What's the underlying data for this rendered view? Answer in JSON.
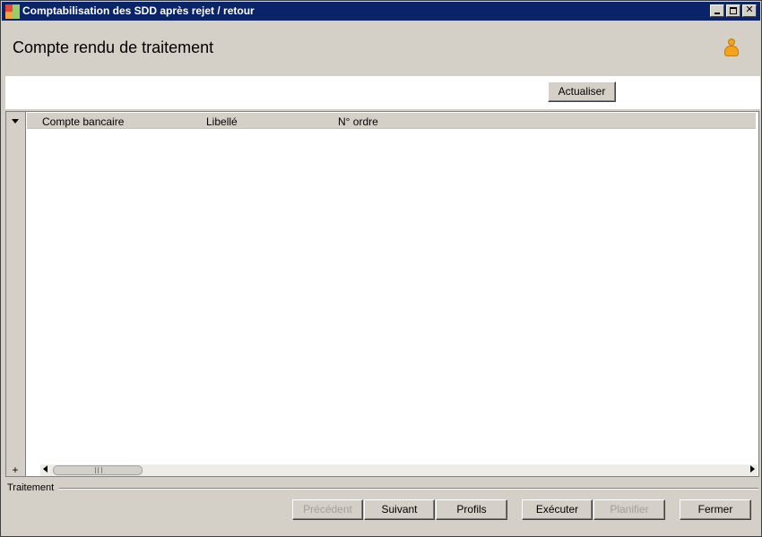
{
  "window": {
    "title": "Comptabilisation des SDD après rejet / retour"
  },
  "header": {
    "page_title": "Compte rendu de traitement",
    "user_icon": "user-icon"
  },
  "toolbar": {
    "refresh_label": "Actualiser"
  },
  "grid": {
    "columns": [
      "Compte bancaire",
      "Libellé",
      "N° ordre"
    ],
    "rows": []
  },
  "status": {
    "group_label": "Traitement"
  },
  "footer": {
    "prev_label": "Précédent",
    "next_label": "Suivant",
    "profiles_label": "Profils",
    "execute_label": "Exécuter",
    "plan_label": "Planifier",
    "close_label": "Fermer"
  },
  "colors": {
    "titlebar": "#0a246a",
    "window_bg": "#d4d0c8",
    "disabled_text": "#a0a0a0"
  }
}
